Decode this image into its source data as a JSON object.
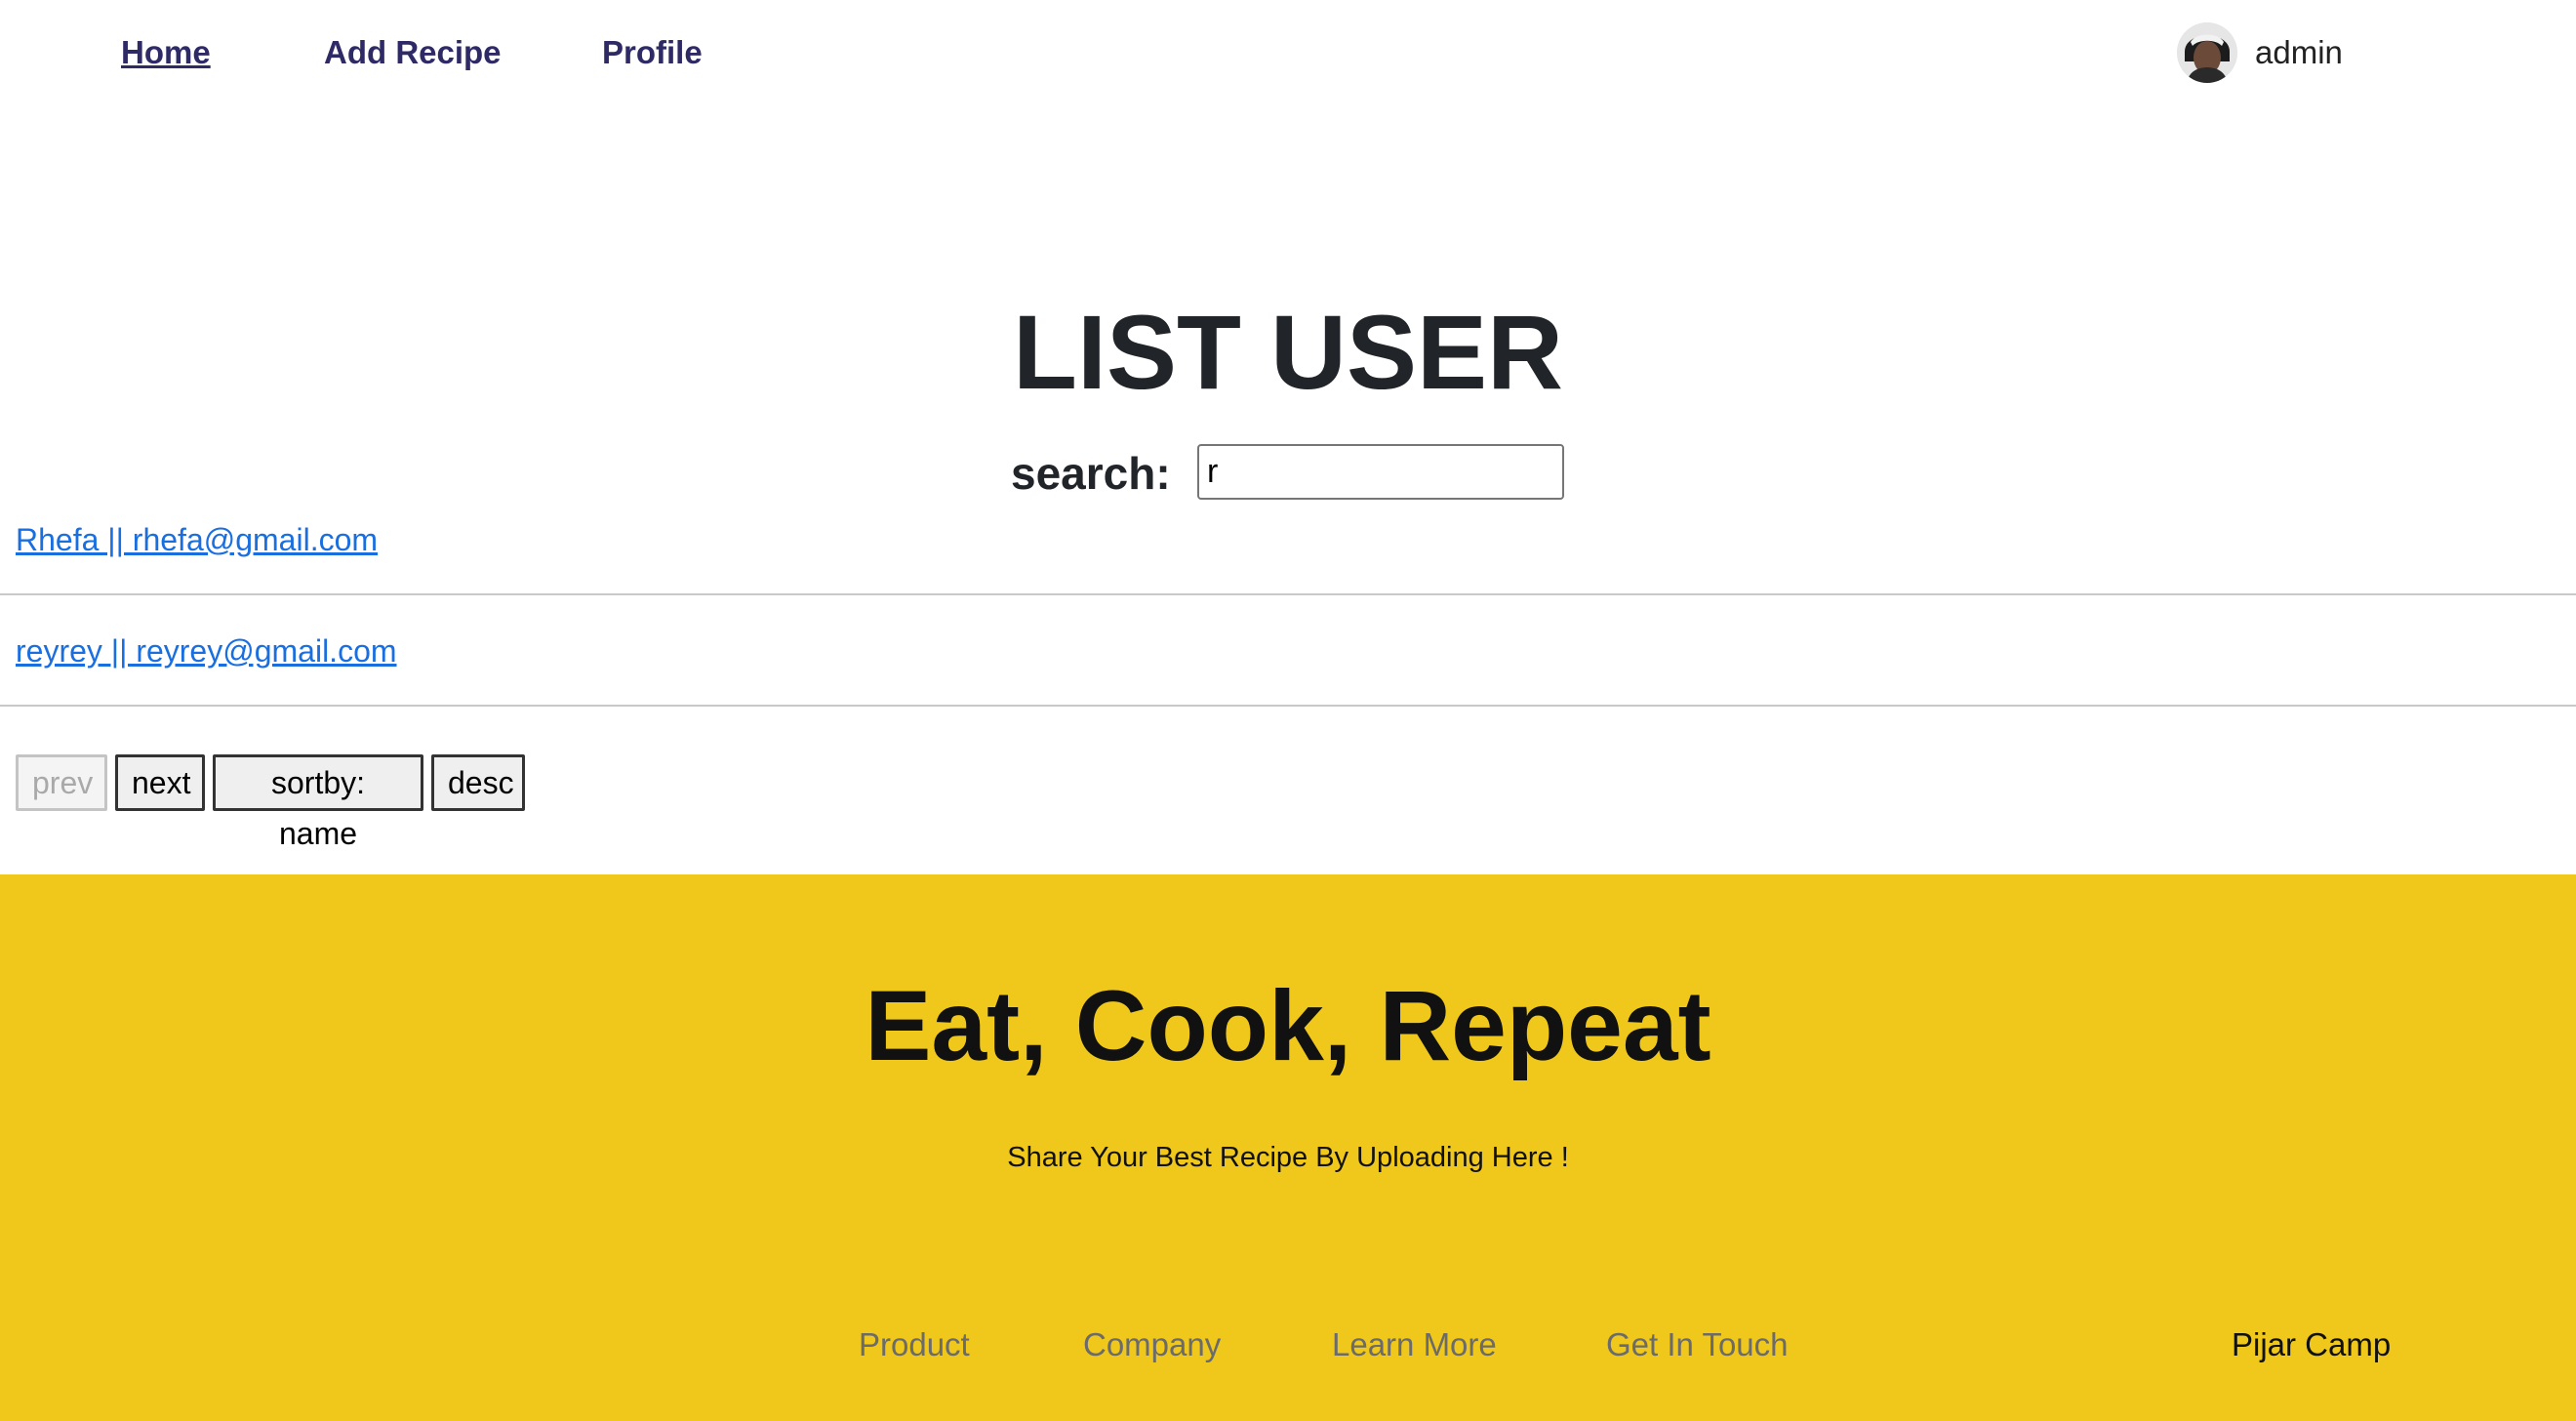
{
  "nav": {
    "links": [
      "Home",
      "Add Recipe",
      "Profile"
    ],
    "user": {
      "name": "admin",
      "avatar_icon": "user-avatar-icon"
    }
  },
  "main": {
    "title": "LIST USER",
    "search_label": "search:",
    "search_value": "r",
    "users": [
      "Rhefa || rhefa@gmail.com",
      "reyrey || reyrey@gmail.com"
    ],
    "buttons": {
      "prev": "prev",
      "next": "next",
      "sort": "sortby: name",
      "order": "desc"
    }
  },
  "footer": {
    "title": "Eat, Cook, Repeat",
    "subtitle": "Share Your Best Recipe By Uploading Here !",
    "links": [
      "Product",
      "Company",
      "Learn More",
      "Get In Touch"
    ],
    "brand": "Pijar Camp",
    "background": "#efc81b"
  },
  "colors": {
    "nav_link": "#2e2a66",
    "link": "#1a6fe0"
  }
}
